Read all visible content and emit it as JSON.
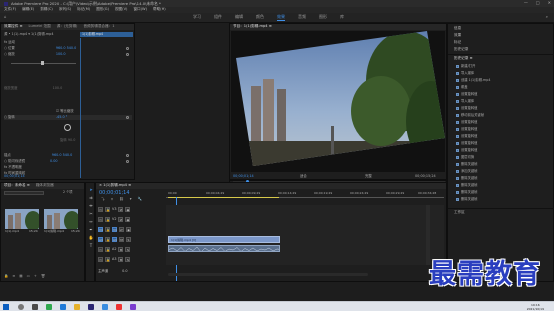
{
  "window": {
    "title": "Adobe Premiere Pro 2020 - C:\\用户\\Video\\示例\\Adobe\\Premiere Pro\\14.0\\未命名 *",
    "controls": [
      "—",
      "□",
      "✕"
    ]
  },
  "menu": [
    "文件(F)",
    "编辑(E)",
    "剪辑(C)",
    "序列(S)",
    "标记(M)",
    "图形(G)",
    "视图(V)",
    "窗口(W)",
    "帮助(H)"
  ],
  "workspaces": [
    "学习",
    "组件",
    "编辑",
    "颜色",
    "效果",
    "音频",
    "图形",
    "库"
  ],
  "workspace_active_index": 4,
  "effect_controls": {
    "tabs": [
      "效果控件 ≡",
      "Lumetri 范围",
      "源：(无剪辑)",
      "音频剪辑混合器：1"
    ],
    "header": "源 • 1(1).mp4 ▾ 1(1)剪辑.mp4",
    "clip_label": "1(1)剪辑.mp4",
    "rows": [
      {
        "label": "fx 运动",
        "value": ""
      },
      {
        "label": "○ 位置",
        "value": "960.0   540.0"
      },
      {
        "label": "○ 缩放",
        "value": "100.0"
      },
      {
        "label": "",
        "value": ""
      },
      {
        "label": "缩放宽度",
        "value": "100.0"
      },
      {
        "label": "",
        "value": "☑ 等比缩放"
      },
      {
        "label": "○ 旋转",
        "value": "-45.0 °"
      },
      {
        "label": "",
        "value": ""
      },
      {
        "label": "锚点",
        "value": "960.0   540.0"
      },
      {
        "label": "○ 防闪烁滤镜",
        "value": "0.00"
      },
      {
        "label": "fx 不透明度",
        "value": ""
      },
      {
        "label": "fx 时间重映射",
        "value": ""
      }
    ],
    "timecode": "00;00;01;14"
  },
  "program_monitor": {
    "tab": "节目：1(1)剪辑.mp4 ≡",
    "timecode_left": "00;00;01;14",
    "timecode_right": "00;00;15;24",
    "fit": "适合",
    "quality": "完整"
  },
  "project": {
    "tabs": [
      "项目：未命名 ≡",
      "媒体浏览器"
    ],
    "item_count": "2 个项",
    "search_placeholder": "",
    "items": [
      {
        "name": "1(1).mp4",
        "duration": "15;24"
      },
      {
        "name": "1(1)剪辑.mp4",
        "duration": "15;24"
      }
    ]
  },
  "timeline": {
    "tab": "× 1(1)剪辑.mp4 ≡",
    "timecode": "00;00;01;14",
    "ruler": [
      "00;00",
      "00;00;04;29",
      "00;00;09;29",
      "00;00;14;29",
      "00;00;19;29",
      "00;00;24;29",
      "00;00;29;29",
      "00;00;34;28"
    ],
    "tracks": [
      {
        "name": "V3",
        "type": "video"
      },
      {
        "name": "V2",
        "type": "video"
      },
      {
        "name": "V1",
        "type": "video",
        "clip": "1(1)剪辑.mp4 [V]"
      },
      {
        "name": "A1",
        "type": "audio",
        "clip": ""
      },
      {
        "name": "A2",
        "type": "audio"
      },
      {
        "name": "A3",
        "type": "audio"
      },
      {
        "name": "主声道",
        "type": "master",
        "value": "0.0"
      }
    ]
  },
  "effects_panel": {
    "tabs": [
      "信息",
      "效果",
      "标记",
      "历史记录"
    ],
    "history_title": "历史记录 ≡",
    "history_items": [
      "新建/打开",
      "导入媒体",
      "创建 1(1)剪辑.mp4",
      "覆盖",
      "设置旋转值",
      "导入媒体",
      "设置旋转值",
      "移动前后关键帧",
      "设置旋转值",
      "设置旋转值",
      "设置旋转值",
      "设置旋转值",
      "设置旋转值",
      "图层切换",
      "删除关键帧",
      "添加关键帧",
      "删除关键帧",
      "删除关键帧",
      "删除关键帧",
      "删除关键帧"
    ],
    "bottom_tab": "工作区"
  },
  "taskbar": {
    "time": "19:16",
    "date": "2021/10/19"
  },
  "watermark": "最需教育",
  "colors": {
    "accent": "#3f8fe6",
    "timeline_clip": "#7b97c9",
    "audio_clip": "#5a6f8c",
    "label_green": "#5aa83c"
  }
}
